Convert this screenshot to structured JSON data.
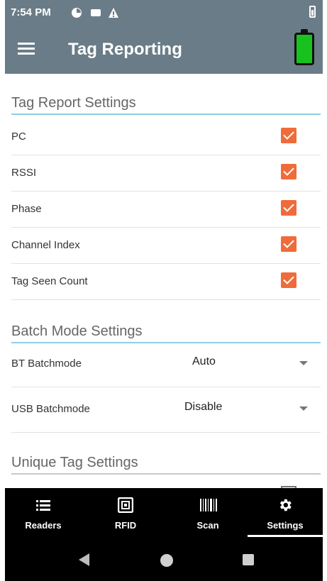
{
  "status_bar": {
    "time": "7:54 PM",
    "icons": [
      "pinwheel-icon",
      "message-icon",
      "warning-icon",
      "battery-status-icon"
    ]
  },
  "app_bar": {
    "title": "Tag Reporting",
    "menu_icon": "hamburger-icon",
    "device_battery_icon": "battery-full-icon",
    "device_battery_color": "#18c21e",
    "background": "#6a7c87"
  },
  "sections": {
    "tag_report": {
      "title": "Tag Report Settings",
      "items": [
        {
          "label": "PC",
          "checked": true
        },
        {
          "label": "RSSI",
          "checked": true
        },
        {
          "label": "Phase",
          "checked": true
        },
        {
          "label": "Channel Index",
          "checked": true
        },
        {
          "label": "Tag Seen Count",
          "checked": true
        }
      ]
    },
    "batch_mode": {
      "title": "Batch Mode Settings",
      "items": [
        {
          "label": "BT Batchmode",
          "value": "Auto"
        },
        {
          "label": "USB Batchmode",
          "value": "Disable"
        }
      ]
    },
    "unique_tag": {
      "title": "Unique Tag Settings"
    }
  },
  "accent_color": "#ef6c3a",
  "section_line_color": "#8ad0e6",
  "bottom_nav": {
    "items": [
      {
        "label": "Readers",
        "icon": "list-icon"
      },
      {
        "label": "RFID",
        "icon": "rfid-tag-icon"
      },
      {
        "label": "Scan",
        "icon": "barcode-icon"
      },
      {
        "label": "Settings",
        "icon": "gear-icon",
        "selected": true
      }
    ]
  },
  "system_nav": {
    "buttons": [
      "back-icon",
      "home-icon",
      "recents-icon"
    ]
  }
}
